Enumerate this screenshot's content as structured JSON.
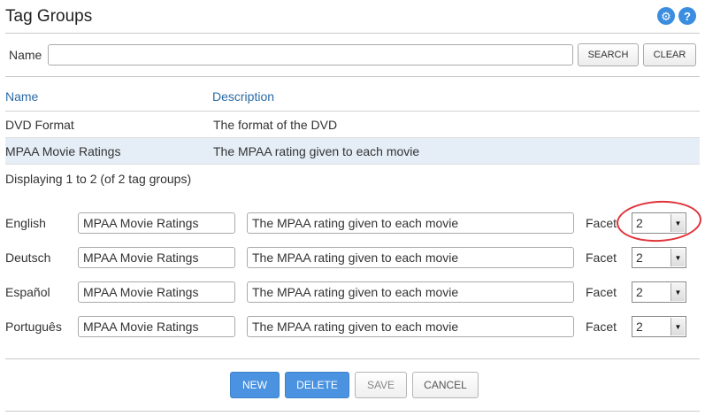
{
  "page": {
    "title": "Tag Groups"
  },
  "header_icons": [
    {
      "name": "settings",
      "glyph": "⚙"
    },
    {
      "name": "help",
      "glyph": "?"
    }
  ],
  "search": {
    "label": "Name",
    "value": "",
    "placeholder": "",
    "search_label": "SEARCH",
    "clear_label": "CLEAR"
  },
  "table": {
    "columns": [
      "Name",
      "Description"
    ],
    "rows": [
      {
        "name": "DVD Format",
        "description": "The format of the DVD",
        "selected": false
      },
      {
        "name": "MPAA Movie Ratings",
        "description": "The MPAA rating given to each movie",
        "selected": true
      }
    ],
    "status": "Displaying 1 to 2 (of 2 tag groups)"
  },
  "translations": [
    {
      "language": "English",
      "name": "MPAA Movie Ratings",
      "description": "The MPAA rating given to each movie",
      "facet_label": "Facet",
      "facet_value": "2"
    },
    {
      "language": "Deutsch",
      "name": "MPAA Movie Ratings",
      "description": "The MPAA rating given to each movie",
      "facet_label": "Facet",
      "facet_value": "2"
    },
    {
      "language": "Español",
      "name": "MPAA Movie Ratings",
      "description": "The MPAA rating given to each movie",
      "facet_label": "Facet",
      "facet_value": "2"
    },
    {
      "language": "Português",
      "name": "MPAA Movie Ratings",
      "description": "The MPAA rating given to each movie",
      "facet_label": "Facet",
      "facet_value": "2"
    }
  ],
  "actions": {
    "new_label": "NEW",
    "delete_label": "DELETE",
    "save_label": "SAVE",
    "cancel_label": "CANCEL"
  },
  "colors": {
    "accent": "#4b93e0",
    "link": "#2a6aa6",
    "highlight": "#e0333a",
    "selected_row": "#e5eef7"
  }
}
